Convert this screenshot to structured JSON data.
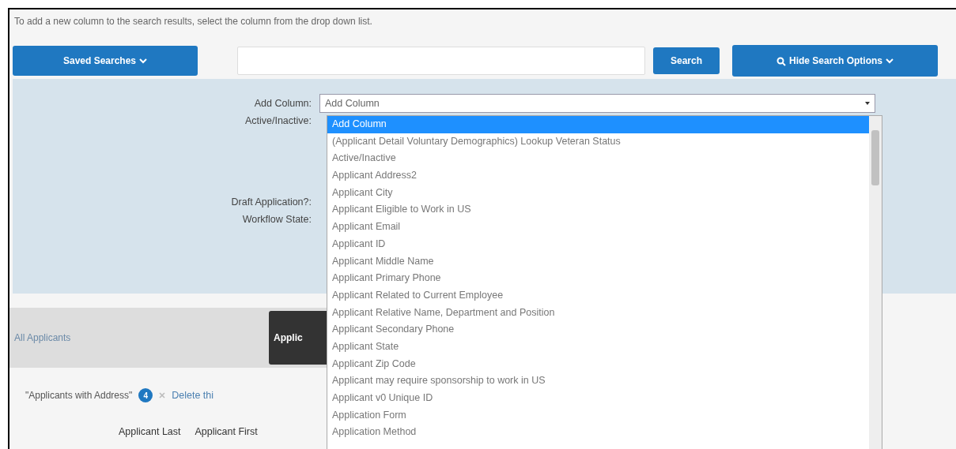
{
  "instructions": "To add a new column to the search results, select the column from the drop down list.",
  "toolbar": {
    "saved_searches": "Saved Searches",
    "search_button": "Search",
    "hide_options": "Hide Search Options"
  },
  "filters": [
    {
      "label": "Add Column:"
    },
    {
      "label": "Active/Inactive:"
    },
    {
      "label": "Draft Application?:"
    },
    {
      "label": "Workflow State:"
    }
  ],
  "add_column_select": {
    "value": "Add Column",
    "expanded": true,
    "options": [
      {
        "label": "Add Column",
        "selected": true
      },
      {
        "label": "(Applicant Detail Voluntary Demographics) Lookup Veteran Status",
        "selected": false
      },
      {
        "label": "Active/Inactive",
        "selected": false
      },
      {
        "label": "Applicant Address2",
        "selected": false
      },
      {
        "label": "Applicant City",
        "selected": false
      },
      {
        "label": "Applicant Eligible to Work in US",
        "selected": false
      },
      {
        "label": "Applicant Email",
        "selected": false
      },
      {
        "label": "Applicant ID",
        "selected": false
      },
      {
        "label": "Applicant Middle Name",
        "selected": false
      },
      {
        "label": "Applicant Primary Phone",
        "selected": false
      },
      {
        "label": "Applicant Related to Current Employee",
        "selected": false
      },
      {
        "label": "Applicant Relative Name, Department and Position",
        "selected": false
      },
      {
        "label": "Applicant Secondary Phone",
        "selected": false
      },
      {
        "label": "Applicant State",
        "selected": false
      },
      {
        "label": "Applicant Zip Code",
        "selected": false
      },
      {
        "label": "Applicant may require sponsorship to work in US",
        "selected": false
      },
      {
        "label": "Applicant v0 Unique ID",
        "selected": false
      },
      {
        "label": "Application Form",
        "selected": false
      },
      {
        "label": "Application Method",
        "selected": false
      }
    ]
  },
  "tabs": [
    {
      "label": "All Applicants",
      "selected": false
    },
    {
      "label": "Applic",
      "selected": true
    }
  ],
  "saved_search": {
    "name": "\"Applicants with Address\"",
    "count": "4",
    "delete": "Delete thi"
  },
  "table": {
    "columns": [
      "Applicant Last",
      "Applicant First"
    ]
  }
}
